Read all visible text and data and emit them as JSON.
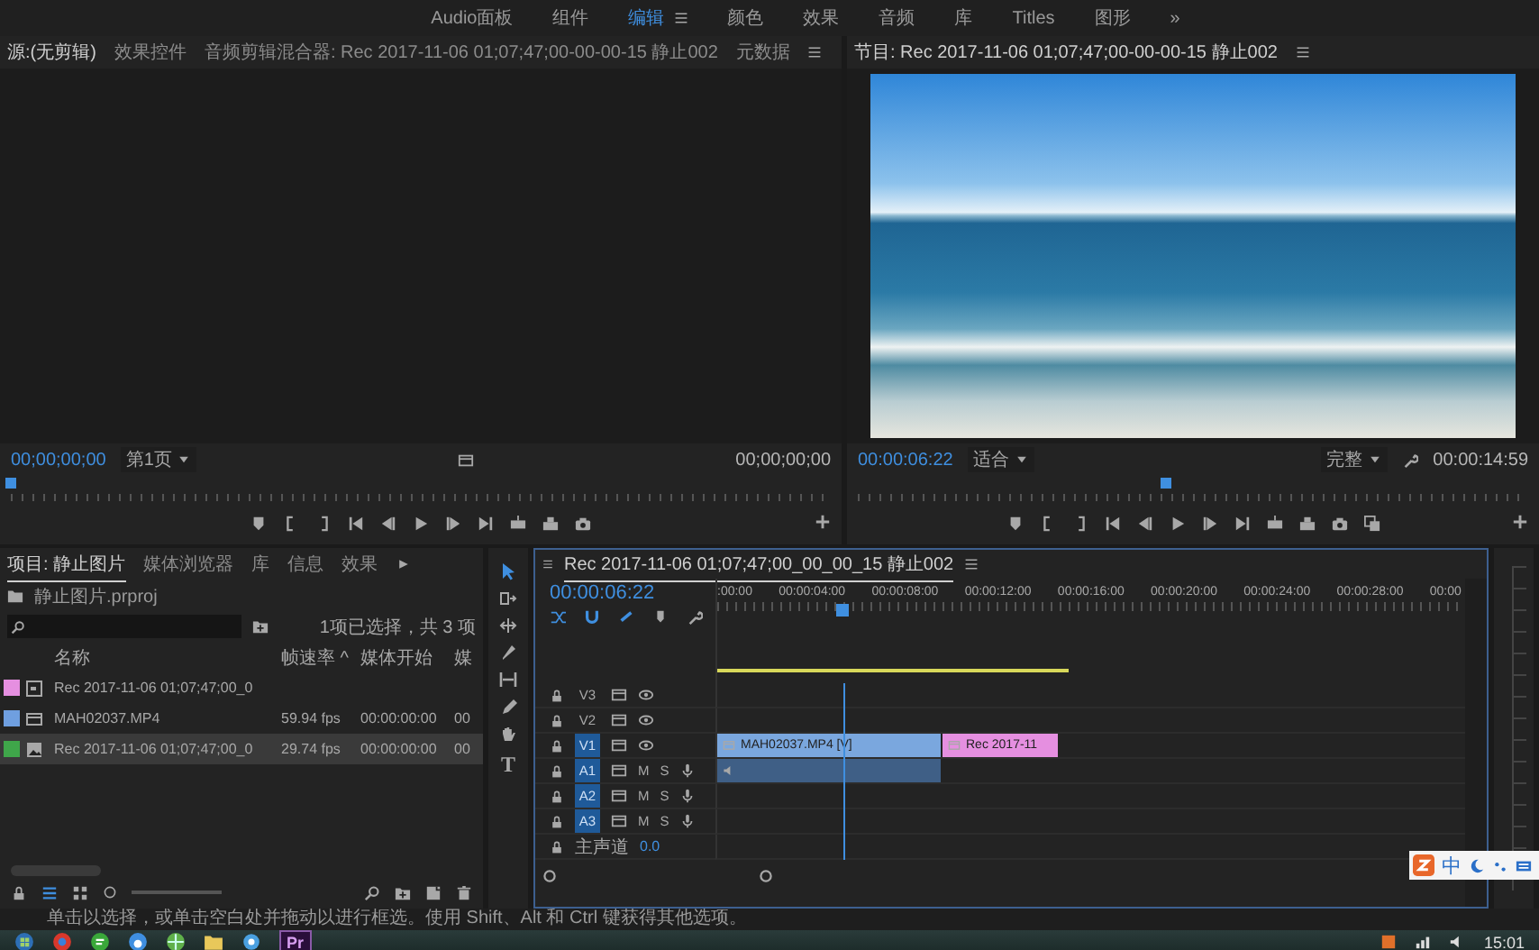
{
  "workspaces": [
    {
      "label": "Audio面板",
      "selected": false
    },
    {
      "label": "组件",
      "selected": false
    },
    {
      "label": "编辑",
      "selected": true
    },
    {
      "label": "颜色",
      "selected": false
    },
    {
      "label": "效果",
      "selected": false
    },
    {
      "label": "音频",
      "selected": false
    },
    {
      "label": "库",
      "selected": false
    },
    {
      "label": "Titles",
      "selected": false
    },
    {
      "label": "图形",
      "selected": false
    }
  ],
  "workspace_more": "»",
  "source_monitor": {
    "kind": "source",
    "tabs": [
      {
        "label": "源:(无剪辑)",
        "selected": true
      },
      {
        "label": "效果控件",
        "selected": false
      },
      {
        "label": "音频剪辑混合器: Rec 2017-11-06 01;07;47;00-00-00-15 静止002",
        "selected": false
      },
      {
        "label": "元数据",
        "selected": false
      }
    ],
    "timecode": "00;00;00;00",
    "zoom": "第1页",
    "duration": "00;00;00;00",
    "playhead": {
      "level": 0
    }
  },
  "program_monitor": {
    "kind": "program",
    "tabs": [
      {
        "label": "节目: Rec 2017-11-06 01;07;47;00-00-00-15 静止002",
        "selected": true
      }
    ],
    "timecode": "00:00:06:22",
    "zoom": "适合",
    "quality": "完整",
    "duration": "00:00:14:59",
    "playhead": {
      "level": 0.46
    }
  },
  "project_panel": {
    "tabs": [
      {
        "label": "项目: 静止图片",
        "selected": true
      },
      {
        "label": "媒体浏览器",
        "selected": false
      },
      {
        "label": "库",
        "selected": false
      },
      {
        "label": "信息",
        "selected": false
      },
      {
        "label": "效果",
        "selected": false
      }
    ],
    "project_name": "静止图片.prproj",
    "selection_info": "1项已选择，共 3 项",
    "columns": [
      "名称",
      "帧速率 ^",
      "媒体开始",
      "媒"
    ],
    "rows": [
      {
        "name": "Rec 2017-11-06 01;07;47;00_0",
        "frame_rate": "",
        "media_start": "",
        "column_4": "",
        "color": "#e58fe0",
        "selected": false
      },
      {
        "name": "MAH02037.MP4",
        "frame_rate": "59.94 fps",
        "media_start": "00:00:00:00",
        "column_4": "00",
        "color": "#6f9fe0",
        "selected": false
      },
      {
        "name": "Rec 2017-11-06 01;07;47;00_0",
        "frame_rate": "29.74 fps",
        "media_start": "00:00:00:00",
        "column_4": "00",
        "color": "#3fa64a",
        "selected": true
      }
    ]
  },
  "tools": {
    "type_tool": "T"
  },
  "timeline": {
    "title": "Rec 2017-11-06 01;07;47;00_00_00_15 静止002",
    "timecode": "00:00:06:22",
    "ruler_labels": [
      ":00:00",
      "00:00:04:00",
      "00:00:08:00",
      "00:00:12:00",
      "00:00:16:00",
      "00:00:20:00",
      "00:00:24:00",
      "00:00:28:00",
      "00:00"
    ],
    "playhead": {
      "level": 0.167
    },
    "work_area": {
      "level": 0.47
    },
    "tracks": [
      {
        "name": "V3",
        "kind": "video",
        "targeted": false
      },
      {
        "name": "V2",
        "kind": "video",
        "targeted": false
      },
      {
        "name": "V1",
        "kind": "video",
        "targeted": true,
        "clips": [
          {
            "label": "MAH02037.MP4 [V]",
            "color": "#7aa7de"
          },
          {
            "label": "Rec 2017-11",
            "color": "#e58fe0"
          }
        ]
      },
      {
        "name": "A1",
        "kind": "audio",
        "targeted": true,
        "buttons": [
          "M",
          "S"
        ],
        "clips": [
          {
            "color": "#3f5f86"
          }
        ]
      },
      {
        "name": "A2",
        "kind": "audio",
        "targeted": true,
        "buttons": [
          "M",
          "S"
        ]
      },
      {
        "name": "A3",
        "kind": "audio",
        "targeted": true,
        "buttons": [
          "M",
          "S"
        ]
      },
      {
        "name": "主声道",
        "kind": "master",
        "targeted": false,
        "value": "0.0"
      }
    ]
  },
  "ime_bar": {
    "label": "中"
  },
  "status_bar": "单击以选择，或单击空白处并拖动以进行框选。使用 Shift、Alt 和 Ctrl 键获得其他选项。",
  "taskbar": {
    "app_label": "Pr",
    "clock": "15:01"
  }
}
